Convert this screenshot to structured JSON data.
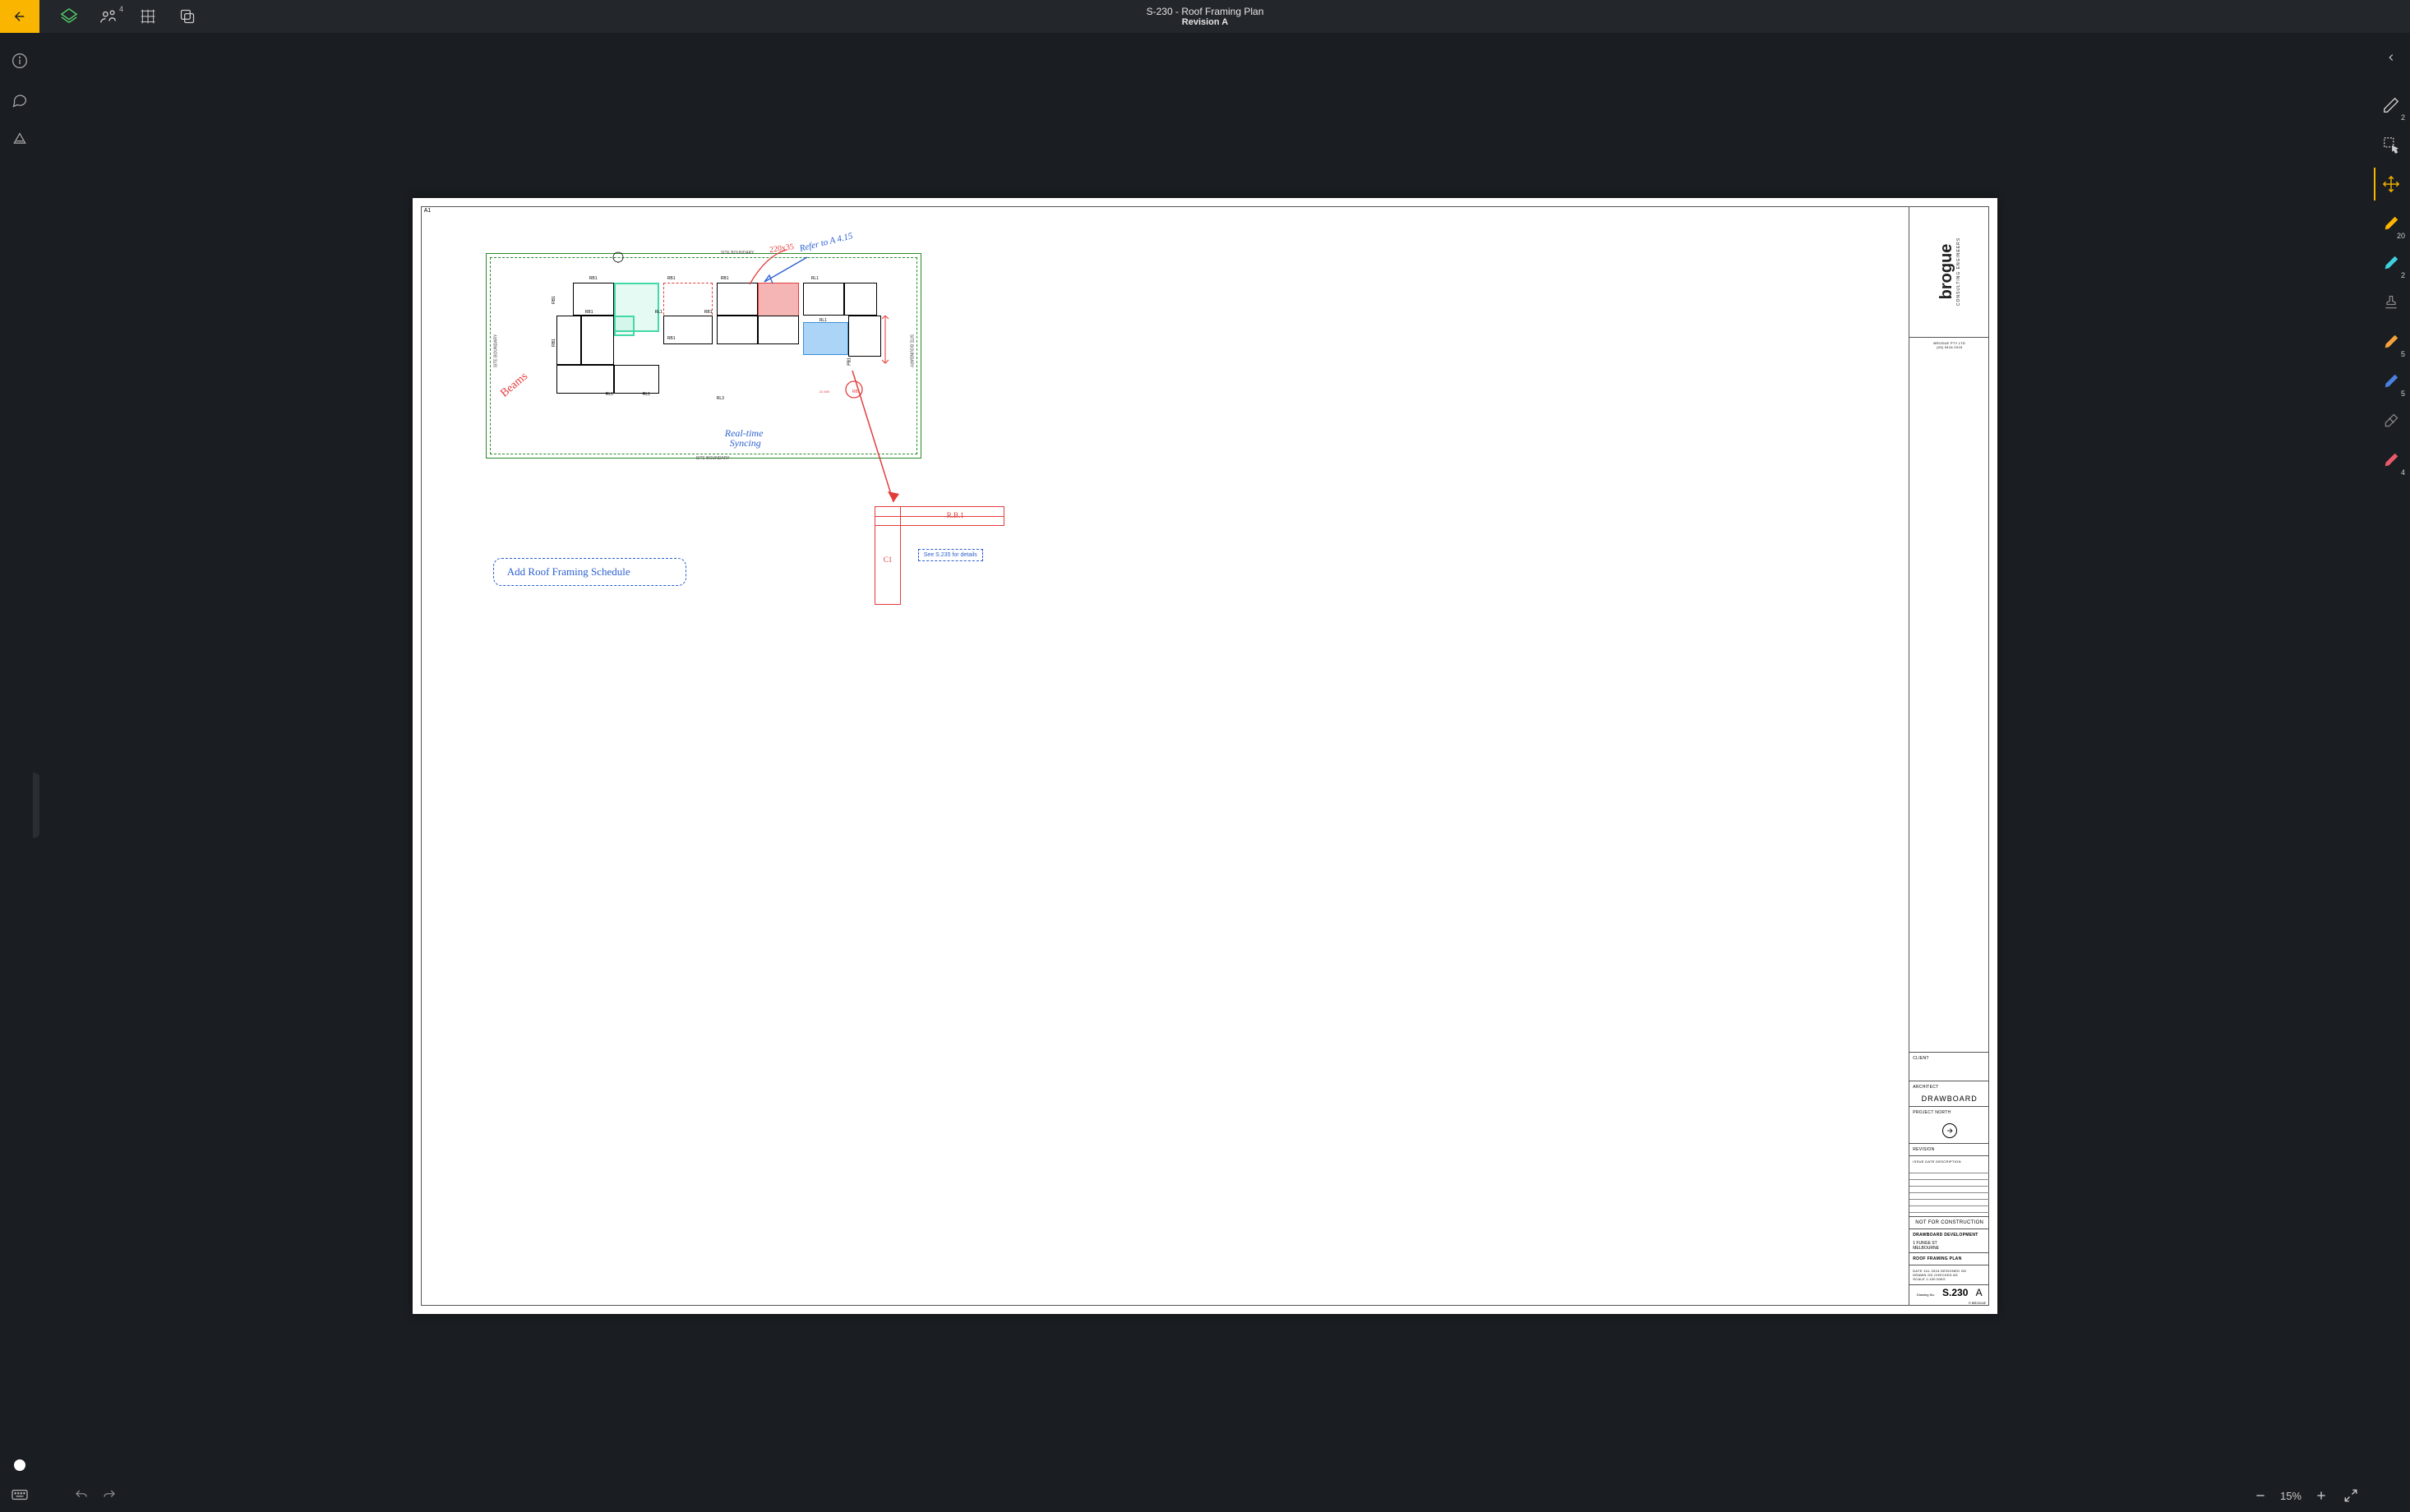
{
  "header": {
    "title": "S-230 - Roof Framing Plan",
    "subtitle": "Revision A",
    "collab_badge": "4"
  },
  "left_tools": {
    "info": "info-icon",
    "comment": "comment-icon",
    "cone": "cone-icon"
  },
  "right_tools": {
    "pen_count": "2",
    "highlighter_count": "20",
    "cyan_pen_count": "2",
    "orange_pen_count": "5",
    "blue_pen_count": "5",
    "red_pen_count": "4"
  },
  "footer": {
    "zoom_level": "15%"
  },
  "sheet": {
    "size": "A1",
    "titleblock": {
      "logo": "brogue",
      "logo_sub": "CONSULTING ENGINEERS",
      "logo_contact": "brogue pty ltd<br>(03) 9416 2015",
      "client_label": "CLIENT",
      "architect_label": "ARCHITECT",
      "architect_value": "DRAWBOARD",
      "north_label": "PROJECT NORTH",
      "revision_label": "REVISION",
      "rev_header": "ISSUE   DATE   DESCRIPTION",
      "status": "NOT FOR CONSTRUCTION",
      "project_name": "DRAWBOARD DEVELOPMENT",
      "address1": "1 FUNGE ST",
      "address2": "MELBOURNE",
      "drawing_title": "ROOF FRAMING PLAN",
      "meta_row": "DATE   JUL 2016    DESIGNED   GD\nDRAWN   GD           CHECKED   AS\nSCALE   1:100         DWG                ",
      "sheet_number": "S.230",
      "sheet_rev": "A",
      "copyright": "© BROGUE"
    },
    "site_boundary_label": "SITE BOUNDARY",
    "beams": {
      "rb1": "RB1",
      "rl1": "RL1",
      "rl3": "RL3",
      "pb1": "PB1"
    },
    "annotations": {
      "dim1": "220x35",
      "refer": "Refer to A 4.15",
      "beams_note": "Beams",
      "realtime": "Real-time Syncing",
      "schedule": "Add  Roof  Framing  Schedule",
      "detail_rb": "R.B.1",
      "detail_c1": "C1",
      "see_detail": "See S.235 for details",
      "dim_small": "22.495"
    }
  }
}
